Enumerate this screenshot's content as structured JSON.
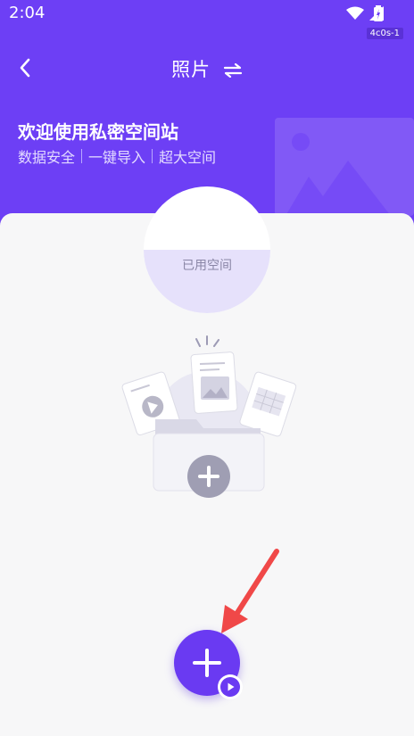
{
  "status_bar": {
    "time": "2:04",
    "tag": "4c0s-1",
    "icons": [
      "wifi-icon",
      "cell-signal-icon",
      "battery-icon"
    ]
  },
  "nav": {
    "title": "照片",
    "back_icon": "chevron-left-icon",
    "switch_icon": "swap-icon"
  },
  "welcome": {
    "title": "欢迎使用私密空间站",
    "features": [
      "数据安全",
      "一键导入",
      "超大空间"
    ]
  },
  "storage": {
    "label": "已用空间",
    "used_fraction": 0.5
  },
  "add_button": {
    "icon": "plus-icon",
    "badge_icon": "play-icon"
  },
  "colors": {
    "primary": "#6d3ff5",
    "fab": "#6a3af2",
    "background": "#f7f7f8",
    "arrow": "#f04848"
  }
}
